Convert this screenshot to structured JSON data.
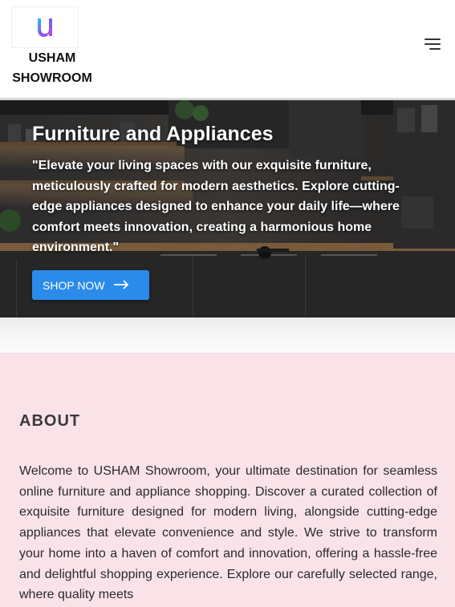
{
  "header": {
    "brand_line1": "USHAM",
    "brand_line2": "SHOWROOM",
    "logo_letter": "U",
    "menu_icon": "hamburger-menu-icon"
  },
  "hero": {
    "title": "Furniture and Appliances",
    "text": "\"Elevate your living spaces with our exquisite furniture, meticulously crafted for modern aesthetics. Explore cutting-edge appliances designed to enhance your daily life—where comfort meets innovation, creating a harmonious home environment.\"",
    "button_label": "SHOP NOW",
    "button_icon": "arrow-right-icon",
    "button_color": "#2a8bea"
  },
  "about": {
    "title": "ABOUT",
    "text": "Welcome to USHAM Showroom, your ultimate destination for seamless online furniture and appliance shopping. Discover a curated collection of exquisite furniture designed for modern living, alongside cutting-edge appliances that elevate convenience and style. We strive to transform your home into a haven of comfort and innovation, offering a hassle-free and delightful shopping experience. Explore our carefully selected range, where quality meets",
    "background": "#f9e3e9"
  }
}
